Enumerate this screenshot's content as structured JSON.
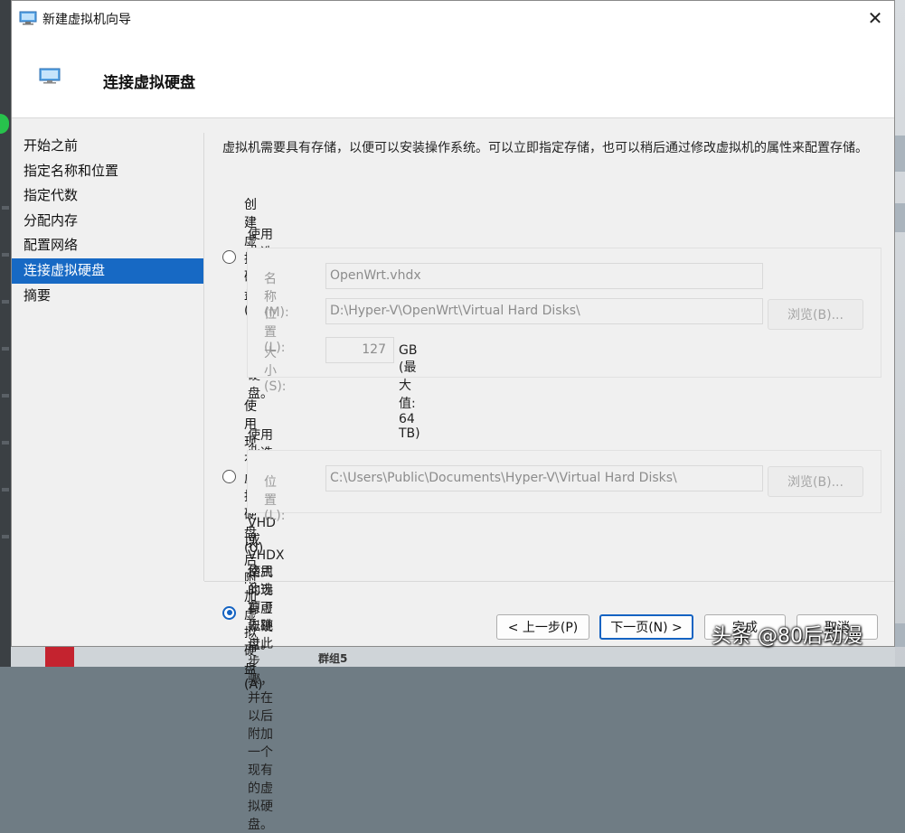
{
  "window": {
    "title": "新建虚拟机向导",
    "close_glyph": "✕",
    "header_title": "连接虚拟硬盘"
  },
  "nav": {
    "items": [
      "开始之前",
      "指定名称和位置",
      "指定代数",
      "分配内存",
      "配置网络",
      "连接虚拟硬盘",
      "摘要"
    ],
    "active_index": 5
  },
  "main": {
    "description": "虚拟机需要具有存储，以便可以安装操作系统。可以立即指定存储，也可以稍后通过修改虚拟机的属性来配置存储。",
    "option_create": {
      "label": "创建虚拟硬盘(C)",
      "checked": false,
      "desc": "使用此选项可创建 VHDX 动态扩展虚拟硬盘。",
      "name_label": "名称(M):",
      "name_value": "OpenWrt.vhdx",
      "location_label": "位置(L):",
      "location_value": "D:\\Hyper-V\\OpenWrt\\Virtual Hard Disks\\",
      "browse_label": "浏览(B)...",
      "size_label": "大小(S):",
      "size_value": "127",
      "size_unit": "GB (最大值: 64 TB)"
    },
    "option_existing": {
      "label": "使用现有虚拟硬盘(U)",
      "checked": false,
      "desc": "使用此选项可附加一个 VHD 或 VHDX 格式的现有虚拟硬盘。",
      "location_label": "位置(L):",
      "location_value": "C:\\Users\\Public\\Documents\\Hyper-V\\Virtual Hard Disks\\",
      "browse_label": "浏览(B)..."
    },
    "option_later": {
      "label": "以后附加虚拟硬盘(A)",
      "checked": true,
      "desc": "使用此选项可先跳过此步骤，并在以后附加一个现有的虚拟硬盘。"
    }
  },
  "footer": {
    "back_label": "< 上一步(P)",
    "next_label": "下一页(N) >",
    "finish_label": "完成",
    "cancel_label": "取消"
  },
  "background": {
    "bottom_text": "群组5",
    "watermark": "头条 @80后动漫"
  },
  "colors": {
    "accent": "#1463c2",
    "nav_active": "#1769c4"
  }
}
